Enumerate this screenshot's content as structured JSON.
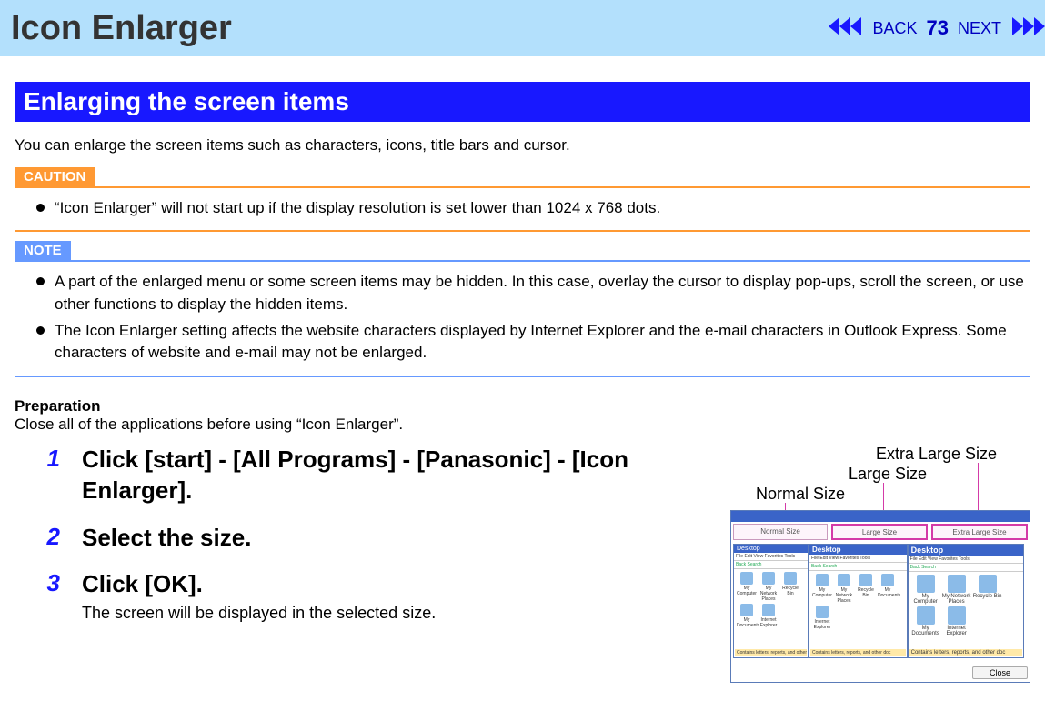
{
  "header": {
    "title": "Icon Enlarger",
    "back": "BACK",
    "next": "NEXT",
    "page": "73"
  },
  "section": {
    "title": "Enlarging the screen items",
    "intro": "You can enlarge the screen items such as characters, icons, title bars and cursor."
  },
  "caution": {
    "label": "CAUTION",
    "items": [
      "“Icon Enlarger” will not start up if the display resolution is set lower than 1024 x 768 dots."
    ]
  },
  "note": {
    "label": "NOTE",
    "items": [
      "A part of the enlarged menu or some screen items may be hidden. In this case, overlay the cursor to display pop-ups, scroll the screen, or use other functions to display the hidden items.",
      "The Icon Enlarger setting affects the website characters displayed by Internet Explorer and the e-mail characters in Outlook Express. Some characters of website and e-mail may not be enlarged."
    ]
  },
  "prep": {
    "heading": "Preparation",
    "text": "Close all of the applications before using “Icon Enlarger”."
  },
  "steps": [
    {
      "num": "1",
      "title": "Click [start] - [All Programs] - [Panasonic] - [Icon Enlarger].",
      "desc": ""
    },
    {
      "num": "2",
      "title": "Select the size.",
      "desc": ""
    },
    {
      "num": "3",
      "title": "Click [OK].",
      "desc": "The screen will be displayed in the selected size."
    }
  ],
  "figure": {
    "labels": {
      "normal": "Normal Size",
      "large": "Large Size",
      "extra": "Extra Large Size"
    },
    "tabs": {
      "normal": "Normal Size",
      "large": "Large Size",
      "extra": "Extra Large Size"
    },
    "preview_title": "Desktop",
    "preview_menu": "File  Edit  View  Favorites  Tools",
    "preview_toolbar": "Back       Search",
    "preview_icons": [
      "My Computer",
      "My Network Places",
      "Recycle Bin",
      "My Documents",
      "Internet Explorer"
    ],
    "preview_status": "Contains letters, reports, and other doc",
    "close": "Close"
  }
}
